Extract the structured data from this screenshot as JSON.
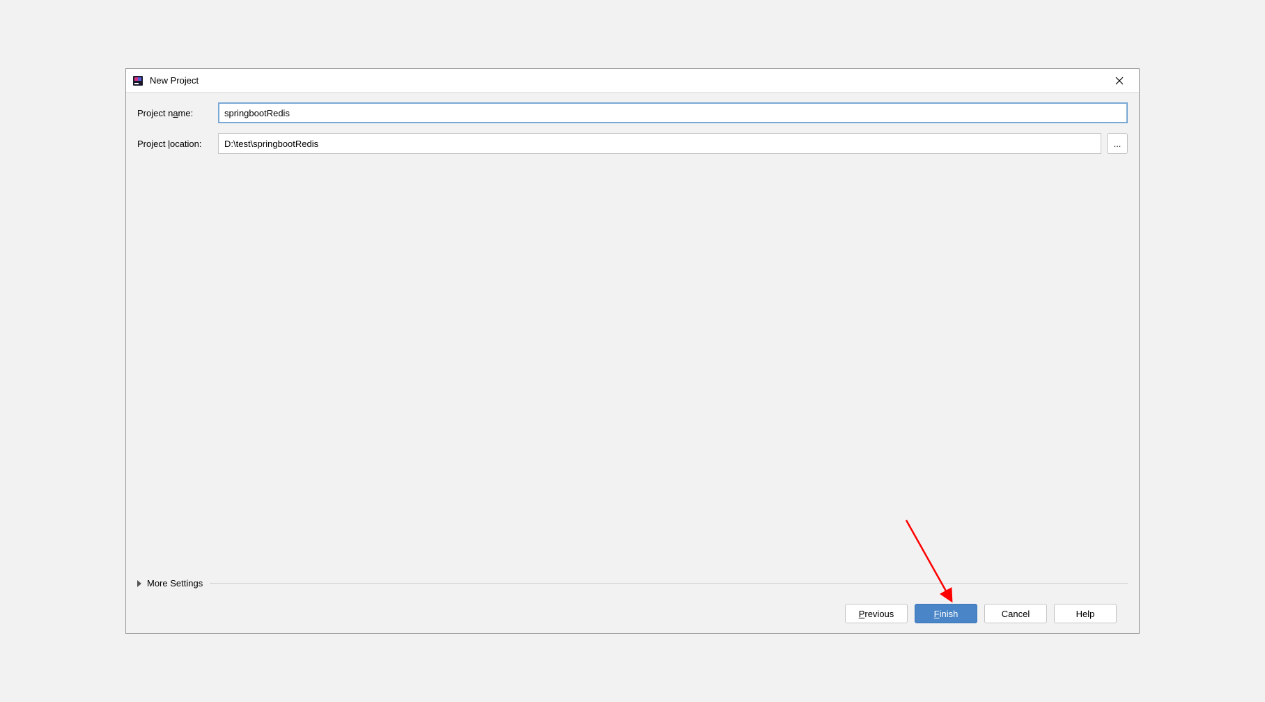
{
  "titlebar": {
    "title": "New Project"
  },
  "form": {
    "project_name_label": "Project name:",
    "project_name_value": "springbootRedis",
    "project_location_label": "Project location:",
    "project_location_value": "D:\\test\\springbootRedis",
    "browse_label": "..."
  },
  "more_settings_label": "More Settings",
  "buttons": {
    "previous": "Previous",
    "finish": "Finish",
    "cancel": "Cancel",
    "help": "Help"
  }
}
